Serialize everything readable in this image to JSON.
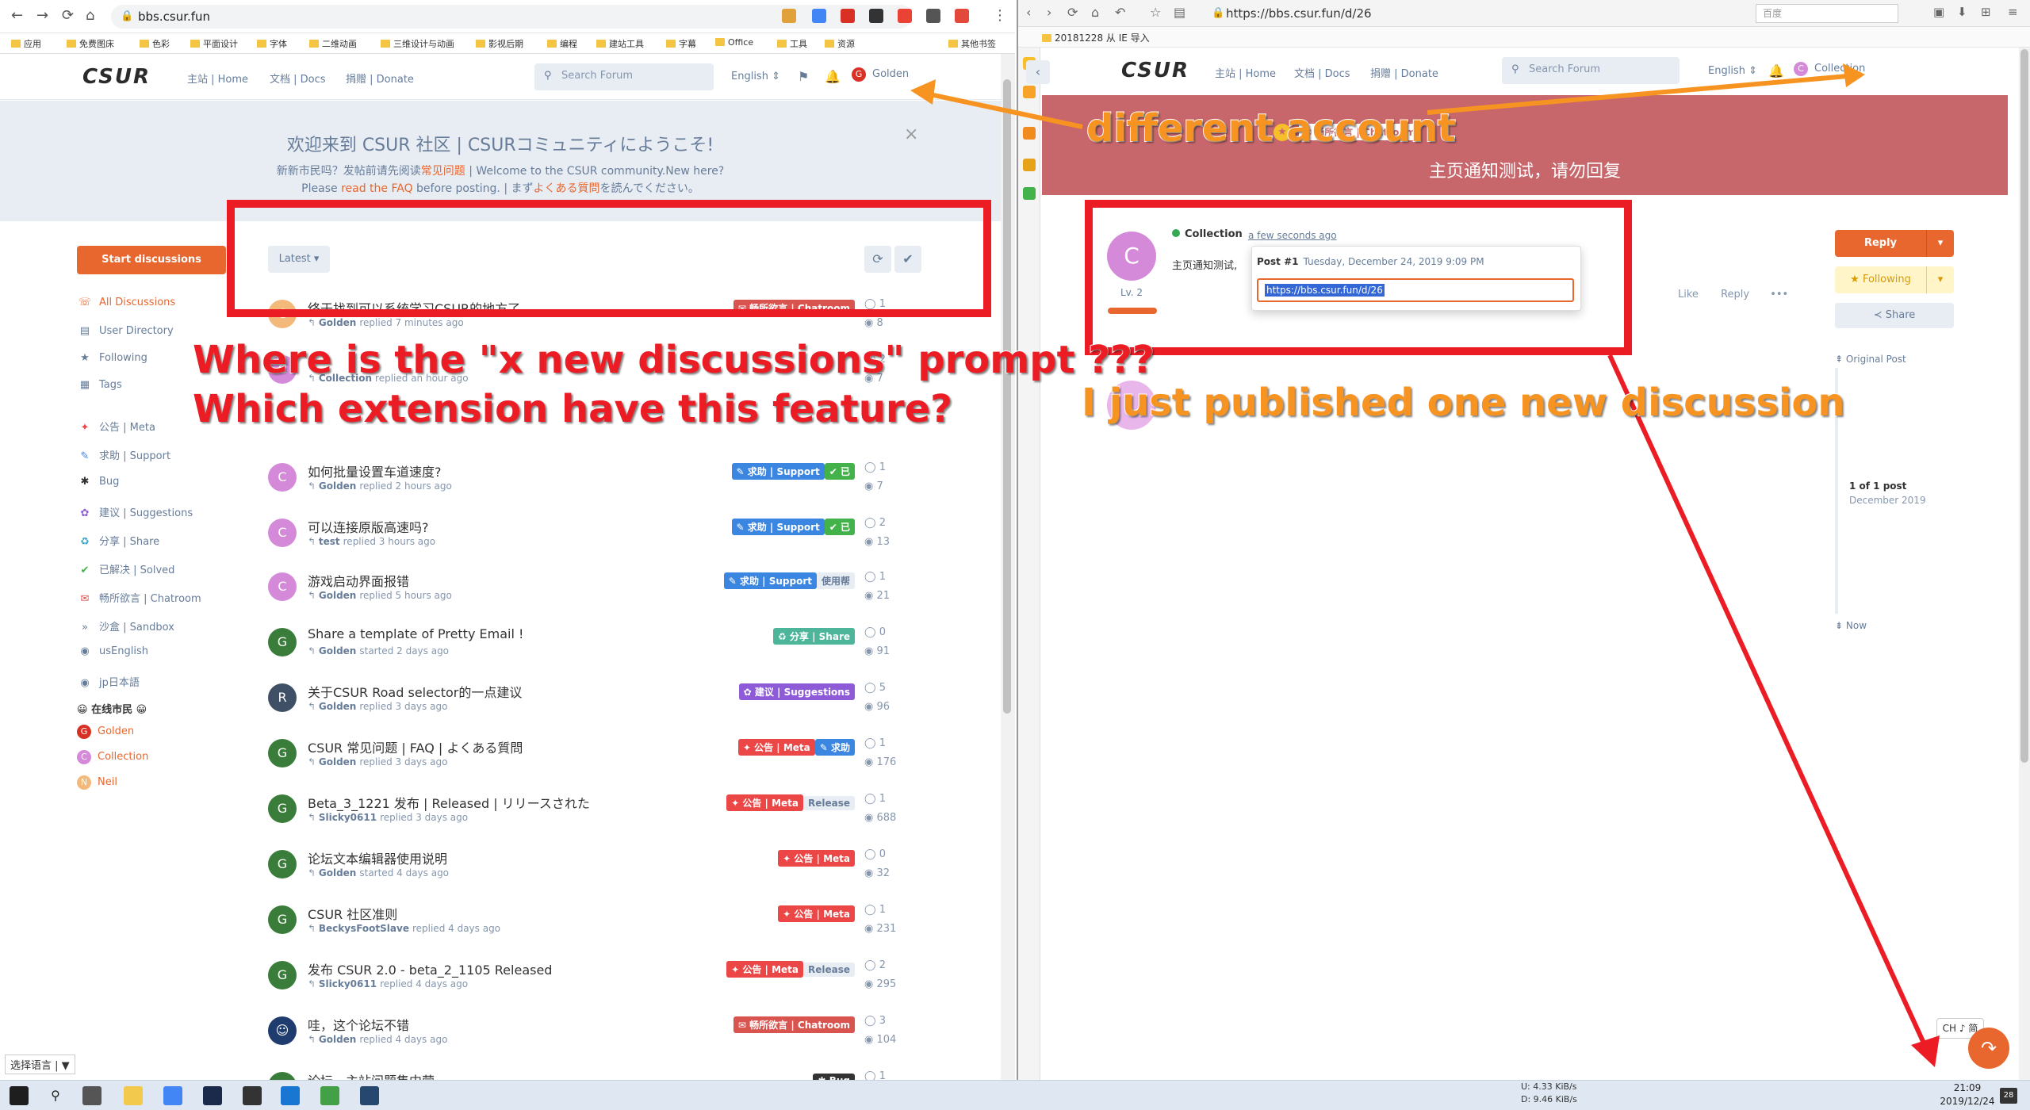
{
  "left": {
    "url": "bbs.csur.fun",
    "bookmarks": [
      "应用",
      "免费图床",
      "色彩",
      "平面设计",
      "字体",
      "二维动画",
      "三维设计与动画",
      "影视后期",
      "编程",
      "建站工具",
      "字幕",
      "Office",
      "工具",
      "资源",
      "其他书签"
    ],
    "header": {
      "logo": "CSUR",
      "nav": [
        "主站 | Home",
        "文档 | Docs",
        "捐赠 | Donate"
      ],
      "search_placeholder": "Search Forum",
      "language": "English",
      "user": "Golden"
    },
    "hero": {
      "title": "欢迎来到 CSUR 社区 | CSURコミュニティにようこそ!",
      "line1_a": "新新市民吗？发帖前请先阅读",
      "line1_link": "常见问题",
      "line1_b": " | Welcome to the CSUR community.New here?",
      "line2_a": "Please ",
      "line2_link1": "read the FAQ",
      "line2_b": " before posting. | まず",
      "line2_link2": "よくある質問",
      "line2_c": "を読んでください。",
      "close": "×"
    },
    "start_button": "Start discussions",
    "sidebar": [
      {
        "icon": "☏",
        "label": "All Discussions",
        "active": true
      },
      {
        "icon": "▤",
        "label": "User Directory"
      },
      {
        "icon": "★",
        "label": "Following"
      },
      {
        "icon": "▦",
        "label": "Tags"
      },
      {
        "icon": "✦",
        "label": "公告 | Meta",
        "color": "#ec4747"
      },
      {
        "icon": "✎",
        "label": "求助 | Support",
        "color": "#3b86e0"
      },
      {
        "icon": "✱",
        "label": "Bug",
        "color": "#333"
      },
      {
        "icon": "✿",
        "label": "建议 | Suggestions",
        "color": "#8e5bd8"
      },
      {
        "icon": "♻",
        "label": "分享 | Share",
        "color": "#38a3c1"
      },
      {
        "icon": "✔",
        "label": "已解决 | Solved",
        "color": "#44b24a"
      },
      {
        "icon": "✉",
        "label": "畅所欲言 | Chatroom",
        "color": "#d9534f"
      },
      {
        "icon": "»",
        "label": "沙盒 | Sandbox",
        "color": "#667c99"
      },
      {
        "icon": "◉",
        "label": "usEnglish",
        "color": "#667c99"
      },
      {
        "icon": "◉",
        "label": "jp日本語",
        "color": "#667c99"
      }
    ],
    "online_title": "😀 在线市民 😀",
    "online_users": [
      {
        "name": "Golden",
        "initial": "G",
        "color": "#d93025"
      },
      {
        "name": "Collection",
        "initial": "C",
        "color": "#d58ad9"
      },
      {
        "name": "Neil",
        "initial": "N",
        "color": "#f2b97a"
      }
    ],
    "toolbar": {
      "sort": "Latest ▾",
      "refresh_icon": "⟳",
      "mark_icon": "✔"
    },
    "discussions": [
      {
        "title": "终于找到可以系统学习CSUR的地方了",
        "user": "Golden",
        "action": "replied 7 minutes ago",
        "tags": [
          {
            "t": "✉ 畅所欲言 | Chatroom",
            "c": "#d9534f"
          }
        ],
        "replies": "1",
        "views": "8",
        "avatar": "C",
        "acolor": "#f2b97a"
      },
      {
        "title": "",
        "user": "Collection",
        "action": "replied an hour ago",
        "tags": [],
        "replies": "2",
        "views": "7",
        "avatar": "C",
        "acolor": "#d58ad9"
      },
      {
        "title": "如何批量设置车道速度?",
        "user": "Golden",
        "action": "replied 2 hours ago",
        "tags": [
          {
            "t": "✎ 求助 | Support",
            "c": "#3b86e0"
          },
          {
            "t": "✔ 已",
            "c": "#44b24a"
          }
        ],
        "replies": "1",
        "views": "7",
        "avatar": "C",
        "acolor": "#d58ad9"
      },
      {
        "title": "可以连接原版高速吗?",
        "user": "test",
        "action": "replied 3 hours ago",
        "tags": [
          {
            "t": "✎ 求助 | Support",
            "c": "#3b86e0"
          },
          {
            "t": "✔ 已",
            "c": "#44b24a"
          }
        ],
        "replies": "2",
        "views": "13",
        "avatar": "C",
        "acolor": "#d58ad9"
      },
      {
        "title": "游戏启动界面报错",
        "user": "Golden",
        "action": "replied 5 hours ago",
        "tags": [
          {
            "t": "✎ 求助 | Support",
            "c": "#3b86e0"
          },
          {
            "t": "使用帮",
            "c": "#e8ecf3",
            "dark": true
          }
        ],
        "replies": "1",
        "views": "21",
        "avatar": "C",
        "acolor": "#d58ad9"
      },
      {
        "title": "Share a template of Pretty Email !",
        "user": "Golden",
        "action": "started 2 days ago",
        "tags": [
          {
            "t": "♻ 分享 | Share",
            "c": "#4cb59a"
          }
        ],
        "replies": "0",
        "views": "91",
        "avatar": "G",
        "acolor": "#3a7d3a"
      },
      {
        "title": "关于CSUR Road selector的一点建议",
        "user": "Golden",
        "action": "replied 3 days ago",
        "tags": [
          {
            "t": "✿ 建议 | Suggestions",
            "c": "#8e5bd8"
          }
        ],
        "replies": "5",
        "views": "96",
        "avatar": "R",
        "acolor": "#3f4f66"
      },
      {
        "title": "CSUR 常见问题   |   FAQ   |   よくある質問",
        "user": "Golden",
        "action": "replied 3 days ago",
        "tags": [
          {
            "t": "✦ 公告 | Meta",
            "c": "#ec4747"
          },
          {
            "t": "✎ 求助",
            "c": "#3b86e0"
          }
        ],
        "replies": "1",
        "views": "176",
        "avatar": "G",
        "acolor": "#3a7d3a"
      },
      {
        "title": "Beta_3_1221 发布 | Released | リリースされた",
        "user": "Slicky0611",
        "action": "replied 3 days ago",
        "tags": [
          {
            "t": "✦ 公告 | Meta",
            "c": "#ec4747"
          },
          {
            "t": "Release",
            "c": "#e8ecf3",
            "dark": true
          }
        ],
        "replies": "1",
        "views": "688",
        "avatar": "G",
        "acolor": "#3a7d3a"
      },
      {
        "title": "论坛文本编辑器使用说明",
        "user": "Golden",
        "action": "started 4 days ago",
        "tags": [
          {
            "t": "✦ 公告 | Meta",
            "c": "#ec4747"
          }
        ],
        "replies": "0",
        "views": "32",
        "avatar": "G",
        "acolor": "#3a7d3a"
      },
      {
        "title": "CSUR 社区准则",
        "user": "BeckysFootSlave",
        "action": "replied 4 days ago",
        "tags": [
          {
            "t": "✦ 公告 | Meta",
            "c": "#ec4747"
          }
        ],
        "replies": "1",
        "views": "231",
        "avatar": "G",
        "acolor": "#3a7d3a"
      },
      {
        "title": "发布 CSUR 2.0 - beta_2_1105 Released",
        "user": "Slicky0611",
        "action": "replied 4 days ago",
        "tags": [
          {
            "t": "✦ 公告 | Meta",
            "c": "#ec4747"
          },
          {
            "t": "Release",
            "c": "#e8ecf3",
            "dark": true
          }
        ],
        "replies": "2",
        "views": "295",
        "avatar": "G",
        "acolor": "#3a7d3a"
      },
      {
        "title": "哇，这个论坛不错",
        "user": "Golden",
        "action": "replied 4 days ago",
        "tags": [
          {
            "t": "✉ 畅所欲言 | Chatroom",
            "c": "#d9534f"
          }
        ],
        "replies": "3",
        "views": "104",
        "avatar": "☺",
        "acolor": "#1f3c6e"
      },
      {
        "title": "论坛、主站问题集中营",
        "user": "",
        "action": "",
        "tags": [
          {
            "t": "✱ Bug",
            "c": "#333"
          }
        ],
        "replies": "1",
        "views": "",
        "avatar": "G",
        "acolor": "#3a7d3a"
      }
    ],
    "lang_selector": "选择语言 | ▼"
  },
  "right": {
    "url": "https://bbs.csur.fun/d/26",
    "search_placeholder": "百度",
    "bookmark": "20181228 从 IE 导入",
    "header": {
      "logo": "CSUR",
      "nav": [
        "主站 | Home",
        "文档 | Docs",
        "捐赠 | Donate"
      ],
      "search_placeholder": "Search Forum",
      "language": "English",
      "user": "Collection"
    },
    "hero": {
      "tag": "✉ 畅所欲言 | Chatroom",
      "title": "主页通知测试，请勿回复"
    },
    "post": {
      "user": "Collection",
      "time": "a few seconds ago",
      "level": "Lv. 2",
      "avatar": "C",
      "body": "主页通知测试,",
      "popup_label": "Post #1",
      "popup_date": "Tuesday, December 24, 2019 9:09 PM",
      "popup_url": "https://bbs.csur.fun/d/26",
      "like": "Like",
      "reply": "Reply",
      "more": "•••"
    },
    "actions": {
      "reply": "Reply",
      "following": "★ Following",
      "share": "≺ Share",
      "caret": "▾"
    },
    "scrubber": {
      "original": "⇞ Original Post",
      "count": "1 of 1 post",
      "date": "December 2019",
      "now": "⇟ Now"
    },
    "ime": "CH ♪ 简",
    "fab": "↷"
  },
  "taskbar": {
    "net_up": "U:     4.33 KiB/s",
    "net_down": "D:     9.46 KiB/s",
    "time": "21:09",
    "date": "2019/12/24",
    "badge": "28"
  },
  "annotations": {
    "q1": "Where is the \"x new discussions\" prompt ???",
    "q2": "Which extension have this feature?",
    "different": "different account",
    "published": "I just published one new discussion"
  }
}
